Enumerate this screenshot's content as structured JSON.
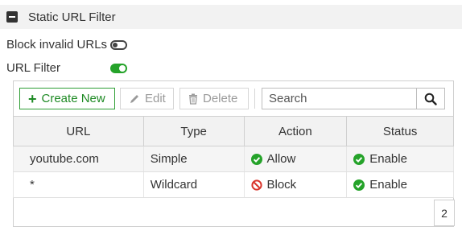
{
  "section": {
    "title": "Static URL Filter",
    "collapse_icon": "minus-square-icon"
  },
  "settings": {
    "block_invalid_urls": {
      "label": "Block invalid URLs",
      "enabled": false
    },
    "url_filter": {
      "label": "URL Filter",
      "enabled": true
    }
  },
  "toolbar": {
    "create_label": "Create New",
    "edit_label": "Edit",
    "delete_label": "Delete",
    "search_placeholder": "Search"
  },
  "table": {
    "headers": [
      "URL",
      "Type",
      "Action",
      "Status"
    ],
    "rows": [
      {
        "url": "youtube.com",
        "type": "Simple",
        "action": "Allow",
        "action_icon": "check-circle-icon",
        "status": "Enable",
        "status_icon": "check-circle-icon"
      },
      {
        "url": "*",
        "type": "Wildcard",
        "action": "Block",
        "action_icon": "block-icon",
        "status": "Enable",
        "status_icon": "check-circle-icon"
      }
    ],
    "count": "2"
  },
  "colors": {
    "accent_green": "#25a32a",
    "block_red": "#d9342b"
  }
}
